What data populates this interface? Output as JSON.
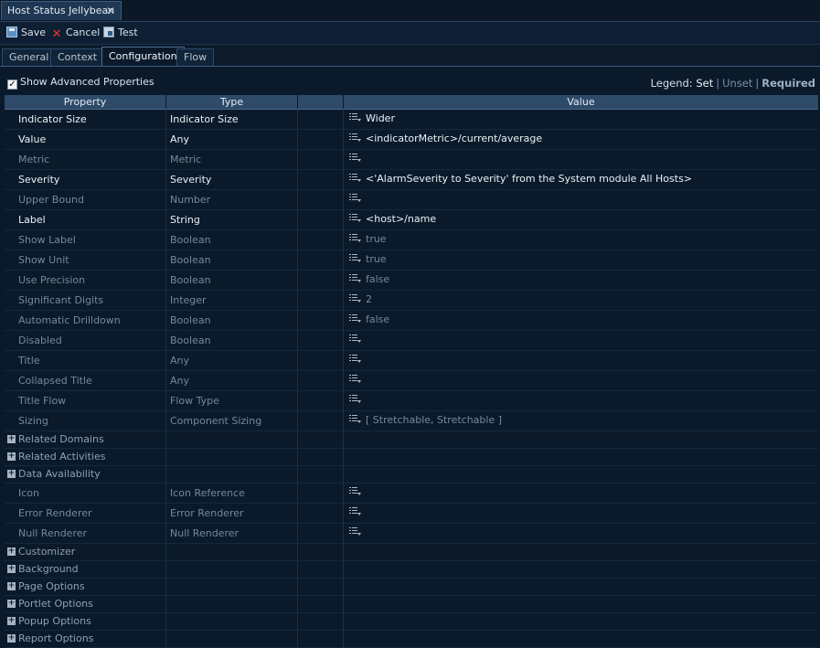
{
  "window": {
    "tab_title": "Host Status Jellybean",
    "close_glyph": "✕"
  },
  "toolbar": {
    "save": "Save",
    "cancel": "Cancel",
    "test": "Test"
  },
  "tabs": [
    {
      "label": "General",
      "active": false
    },
    {
      "label": "Context",
      "active": false
    },
    {
      "label": "Configuration",
      "active": true
    },
    {
      "label": "Flow",
      "active": false
    }
  ],
  "advanced": {
    "label": "Show Advanced Properties",
    "checked": true
  },
  "legend": {
    "prefix": "Legend:",
    "set": "Set",
    "unset": "Unset",
    "required": "Required"
  },
  "columns": {
    "property": "Property",
    "type": "Type",
    "value": "Value"
  },
  "rows": [
    {
      "property": "Indicator Size",
      "type": "Indicator Size",
      "value": "Wider",
      "state": "set"
    },
    {
      "property": "Value",
      "type": "Any",
      "value": "<indicatorMetric>/current/average",
      "state": "set"
    },
    {
      "property": "Metric",
      "type": "Metric",
      "value": "",
      "state": "unset"
    },
    {
      "property": "Severity",
      "type": "Severity",
      "value": "<'AlarmSeverity to Severity' from the System module All Hosts>",
      "state": "set"
    },
    {
      "property": "Upper Bound",
      "type": "Number",
      "value": "",
      "state": "unset"
    },
    {
      "property": "Label",
      "type": "String",
      "value": "<host>/name",
      "state": "set"
    },
    {
      "property": "Show Label",
      "type": "Boolean",
      "value": "true",
      "state": "unset"
    },
    {
      "property": "Show Unit",
      "type": "Boolean",
      "value": "true",
      "state": "unset"
    },
    {
      "property": "Use Precision",
      "type": "Boolean",
      "value": "false",
      "state": "unset"
    },
    {
      "property": "Significant Digits",
      "type": "Integer",
      "value": "2",
      "state": "unset"
    },
    {
      "property": "Automatic Drilldown",
      "type": "Boolean",
      "value": "false",
      "state": "unset"
    },
    {
      "property": "Disabled",
      "type": "Boolean",
      "value": "",
      "state": "unset"
    },
    {
      "property": "Title",
      "type": "Any",
      "value": "",
      "state": "unset"
    },
    {
      "property": "Collapsed Title",
      "type": "Any",
      "value": "",
      "state": "unset"
    },
    {
      "property": "Title Flow",
      "type": "Flow Type",
      "value": "",
      "state": "unset"
    },
    {
      "property": "Sizing",
      "type": "Component Sizing",
      "value": "[ Stretchable, Stretchable ]",
      "state": "unset"
    }
  ],
  "sections1": [
    "Related Domains",
    "Related Activities",
    "Data Availability"
  ],
  "rows2": [
    {
      "property": "Icon",
      "type": "Icon Reference",
      "value": "",
      "state": "unset"
    },
    {
      "property": "Error Renderer",
      "type": "Error Renderer",
      "value": "",
      "state": "unset"
    },
    {
      "property": "Null Renderer",
      "type": "Null Renderer",
      "value": "",
      "state": "unset"
    }
  ],
  "sections2": [
    "Customizer",
    "Background",
    "Page Options",
    "Portlet Options",
    "Popup Options",
    "Report Options"
  ],
  "icons": {
    "save": "save-icon",
    "cancel": "cancel-icon",
    "test": "test-icon",
    "value_menu": "list-menu-icon",
    "expand": "plus-box-icon",
    "expand_glyph": "+",
    "check_glyph": "✓"
  }
}
